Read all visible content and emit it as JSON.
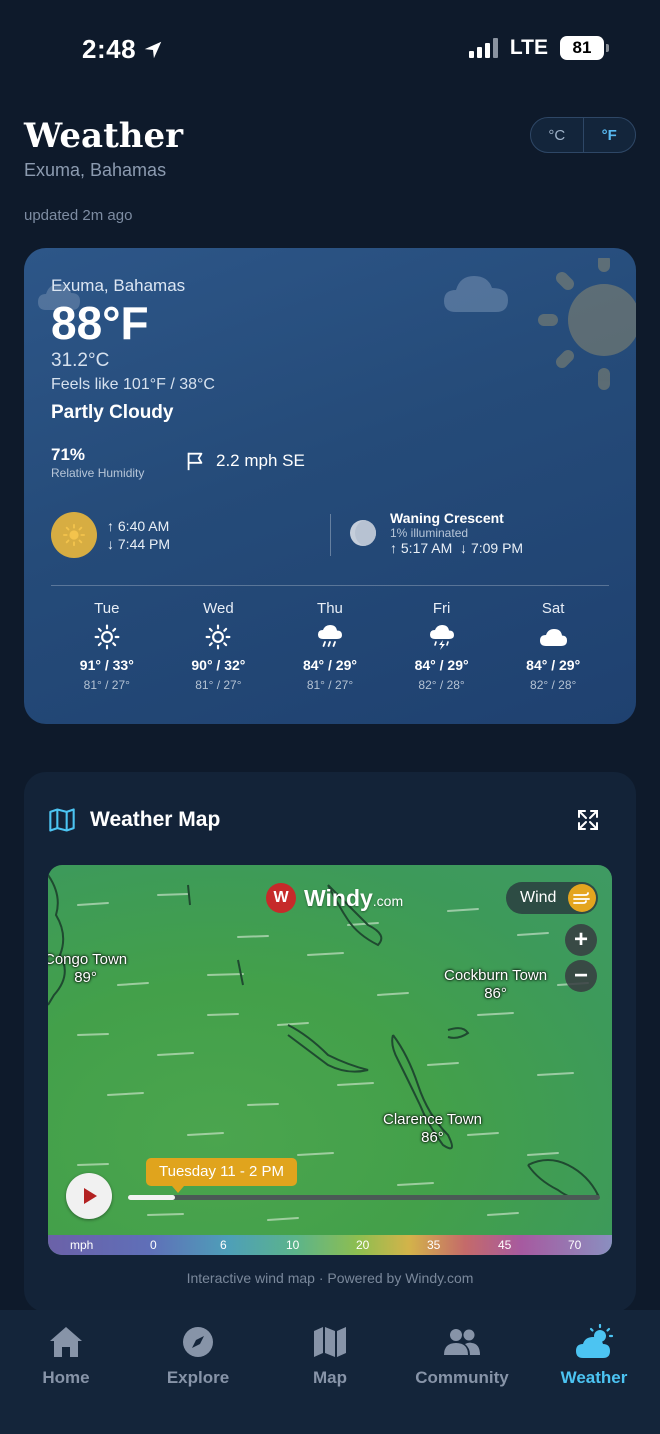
{
  "status": {
    "time": "2:48",
    "network": "LTE",
    "battery": "81"
  },
  "header": {
    "title": "Weather",
    "location": "Exuma, Bahamas",
    "updated": "updated 2m ago",
    "unit_c": "°C",
    "unit_f": "°F"
  },
  "current": {
    "location": "Exuma, Bahamas",
    "temp_f": "88°F",
    "temp_c": "31.2°C",
    "feels_like": "Feels like 101°F / 38°C",
    "condition": "Partly Cloudy",
    "humidity": "71%",
    "humidity_label": "Relative Humidity",
    "wind": "2.2 mph SE",
    "sunrise": "6:40 AM",
    "sunset": "7:44 PM",
    "moon_phase": "Waning Crescent",
    "moon_illumination": "1% illuminated",
    "moonrise": "5:17 AM",
    "moonset": "7:09 PM"
  },
  "forecast": [
    {
      "day": "Tue",
      "icon": "sun-icon",
      "high": "91° / 33°",
      "low": "81° / 27°"
    },
    {
      "day": "Wed",
      "icon": "sun-icon",
      "high": "90° / 32°",
      "low": "81° / 27°"
    },
    {
      "day": "Thu",
      "icon": "rain-cloud-icon",
      "high": "84° / 29°",
      "low": "81° / 27°"
    },
    {
      "day": "Fri",
      "icon": "thunderstorm-icon",
      "high": "84° / 29°",
      "low": "82° / 28°"
    },
    {
      "day": "Sat",
      "icon": "cloud-icon",
      "high": "84° / 29°",
      "low": "82° / 28°"
    }
  ],
  "map": {
    "title": "Weather Map",
    "brand": "Windy",
    "brand_suffix": ".com",
    "layer": "Wind",
    "places": [
      {
        "name": "Congo Town",
        "temp": "89°"
      },
      {
        "name": "Cockburn Town",
        "temp": "86°"
      },
      {
        "name": "Clarence Town",
        "temp": "86°"
      }
    ],
    "timeline_label": "Tuesday 11 - 2 PM",
    "timeline_progress": 0.1,
    "scale_unit": "mph",
    "scale_ticks": [
      "0",
      "6",
      "10",
      "20",
      "35",
      "45",
      "70"
    ],
    "footer": "Interactive wind map · Powered by Windy.com"
  },
  "tabs": [
    {
      "label": "Home",
      "icon": "home-icon"
    },
    {
      "label": "Explore",
      "icon": "compass-icon"
    },
    {
      "label": "Map",
      "icon": "map-icon"
    },
    {
      "label": "Community",
      "icon": "people-icon"
    },
    {
      "label": "Weather",
      "icon": "weather-icon",
      "active": true
    }
  ],
  "colors": {
    "accent": "#4cc4f2",
    "background": "#0e1a2b",
    "windy_orange": "#e0a41d"
  }
}
